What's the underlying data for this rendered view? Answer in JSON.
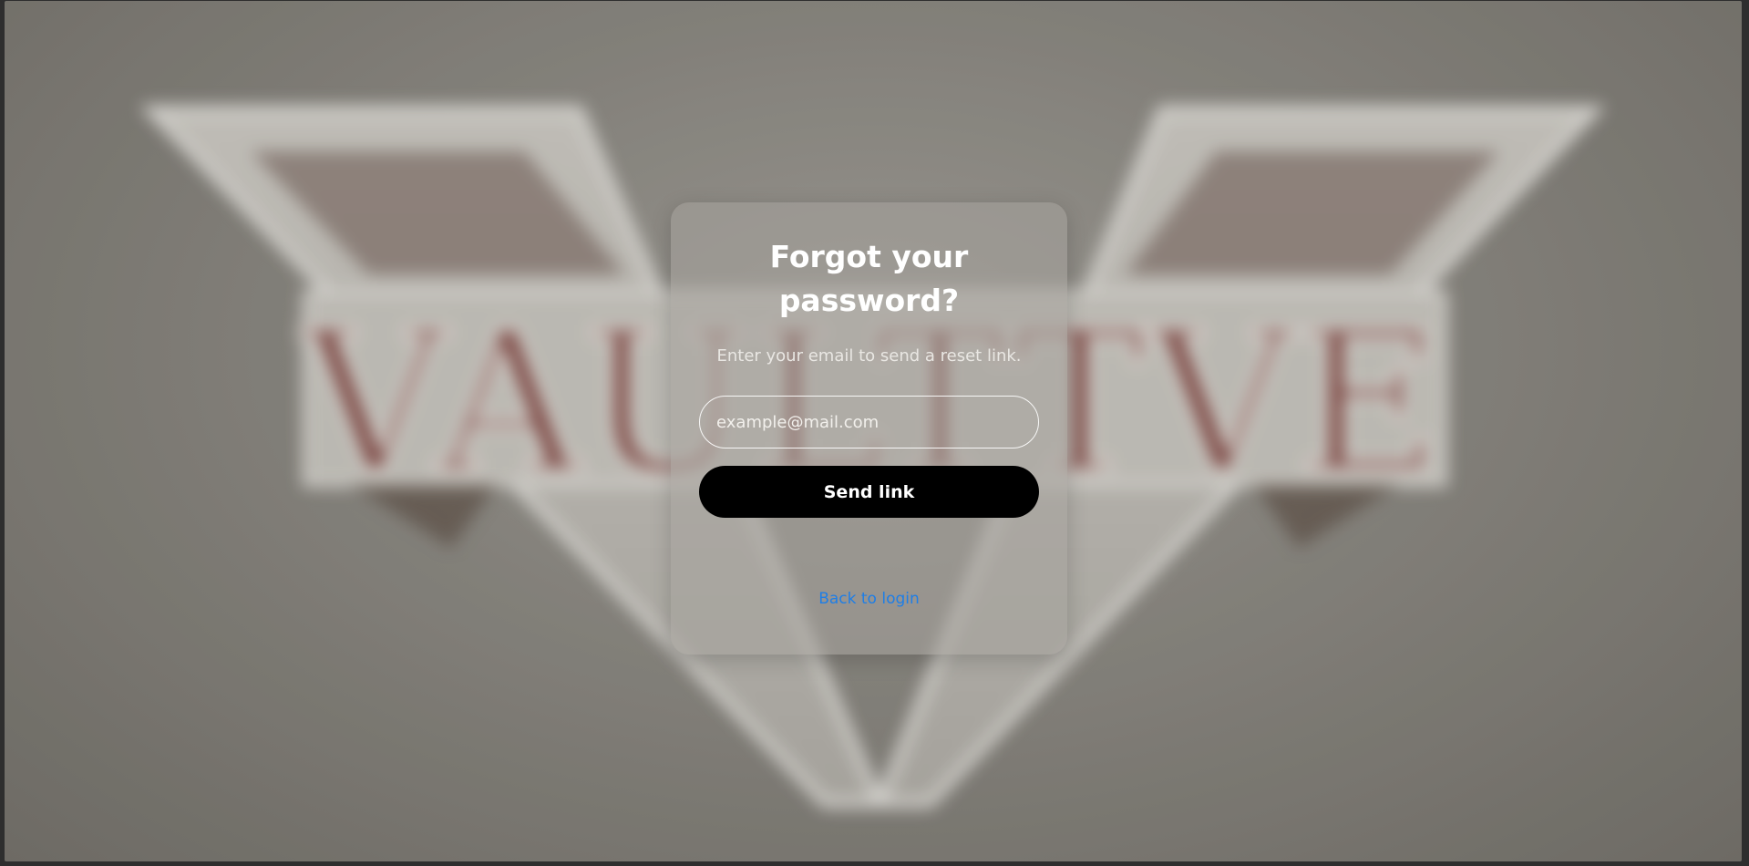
{
  "forgot": {
    "title": "Forgot your password?",
    "subtitle": "Enter your email to send a reset link.",
    "email_placeholder": "example@mail.com",
    "email_value": "",
    "send_label": "Send link",
    "back_label": "Back to login"
  },
  "background": {
    "logo_text": "VAULTTVE"
  },
  "colors": {
    "link": "#1e7ee6",
    "button_bg": "#000000",
    "card_bg": "rgba(165,162,156,0.55)"
  }
}
